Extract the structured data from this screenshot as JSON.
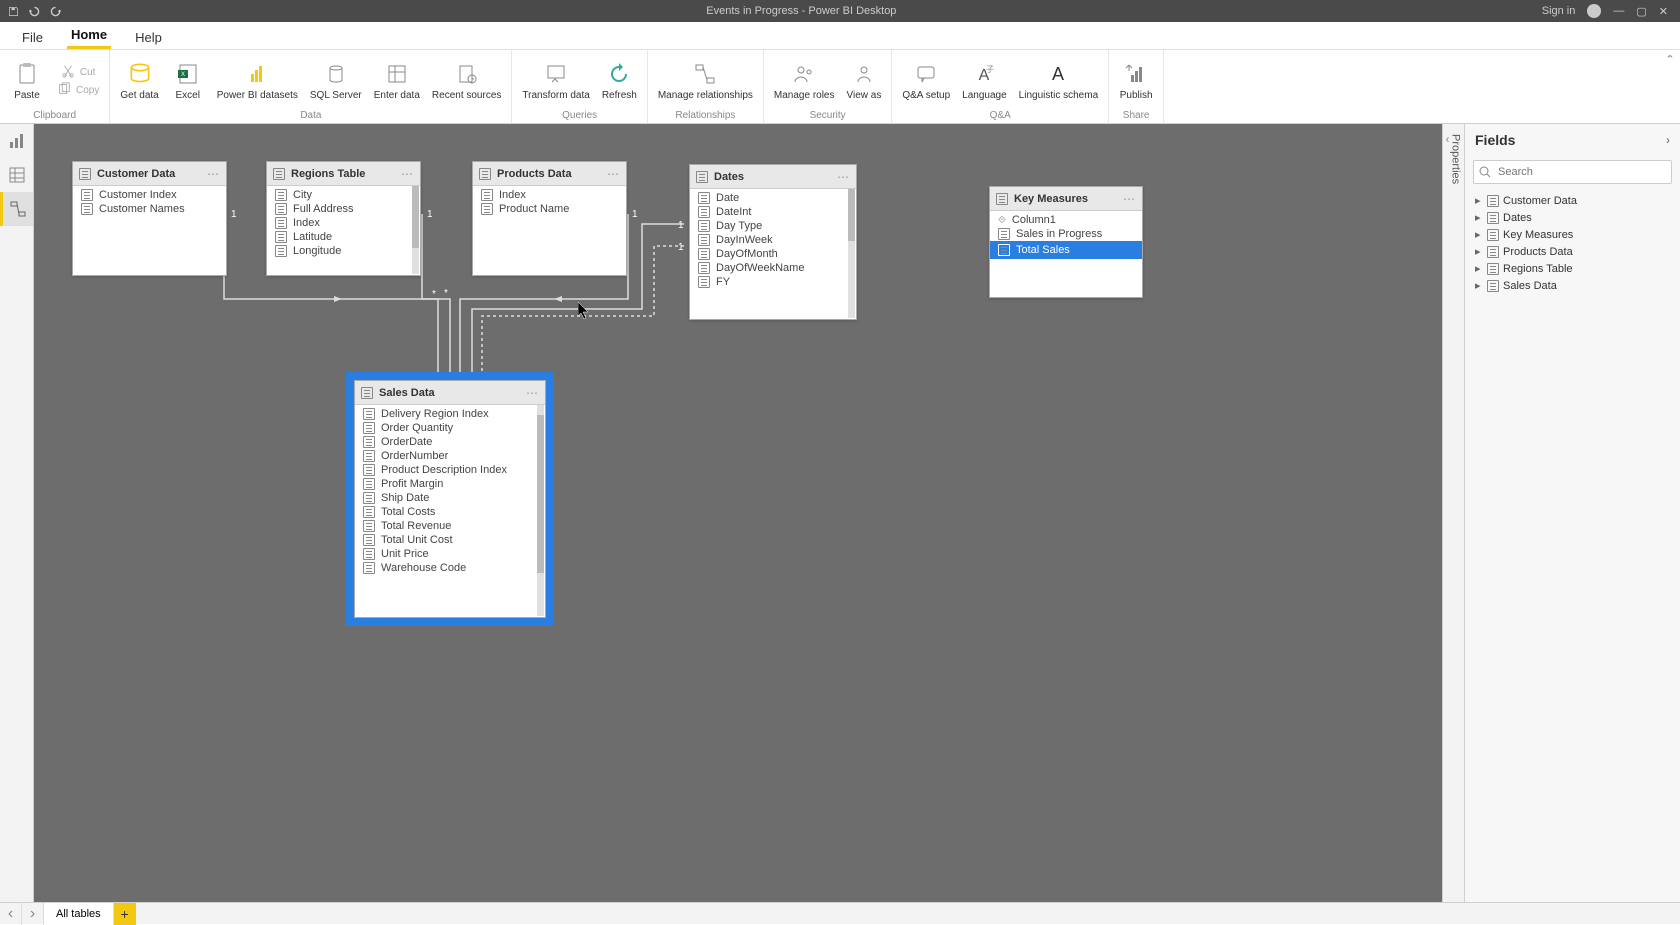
{
  "titlebar": {
    "title": "Events in Progress - Power BI Desktop",
    "signin": "Sign in"
  },
  "menu": {
    "file": "File",
    "home": "Home",
    "help": "Help"
  },
  "ribbon": {
    "clipboard": {
      "label": "Clipboard",
      "paste": "Paste",
      "cut": "Cut",
      "copy": "Copy"
    },
    "data": {
      "label": "Data",
      "get": "Get data",
      "excel": "Excel",
      "pbi": "Power BI datasets",
      "sql": "SQL Server",
      "enter": "Enter data",
      "recent": "Recent sources"
    },
    "queries": {
      "label": "Queries",
      "transform": "Transform data",
      "refresh": "Refresh"
    },
    "relationships": {
      "label": "Relationships",
      "manage": "Manage relationships"
    },
    "security": {
      "label": "Security",
      "roles": "Manage roles",
      "viewas": "View as"
    },
    "qa": {
      "label": "Q&A",
      "setup": "Q&A setup",
      "lang": "Language",
      "ling": "Linguistic schema"
    },
    "share": {
      "label": "Share",
      "publish": "Publish"
    }
  },
  "canvas": {
    "tables": {
      "customer": {
        "title": "Customer Data",
        "fields": [
          "Customer Index",
          "Customer Names"
        ]
      },
      "regions": {
        "title": "Regions Table",
        "fields": [
          "City",
          "Full Address",
          "Index",
          "Latitude",
          "Longitude"
        ]
      },
      "products": {
        "title": "Products Data",
        "fields": [
          "Index",
          "Product Name"
        ]
      },
      "dates": {
        "title": "Dates",
        "fields": [
          "Date",
          "DateInt",
          "Day Type",
          "DayInWeek",
          "DayOfMonth",
          "DayOfWeekName",
          "FY"
        ]
      },
      "key": {
        "title": "Key Measures",
        "fields": [
          "Column1",
          "Sales in Progress",
          "Total Sales"
        ]
      },
      "sales": {
        "title": "Sales Data",
        "fields": [
          "Delivery Region Index",
          "Order Quantity",
          "OrderDate",
          "OrderNumber",
          "Product Description Index",
          "Profit Margin",
          "Ship Date",
          "Total Costs",
          "Total Revenue",
          "Total Unit Cost",
          "Unit Price",
          "Warehouse Code"
        ]
      }
    },
    "cardinality": {
      "one": "1",
      "many": "*"
    }
  },
  "properties": {
    "label": "Properties"
  },
  "fields": {
    "title": "Fields",
    "search": "Search",
    "tables": [
      "Customer Data",
      "Dates",
      "Key Measures",
      "Products Data",
      "Regions Table",
      "Sales Data"
    ]
  },
  "status": {
    "page": "All tables"
  }
}
